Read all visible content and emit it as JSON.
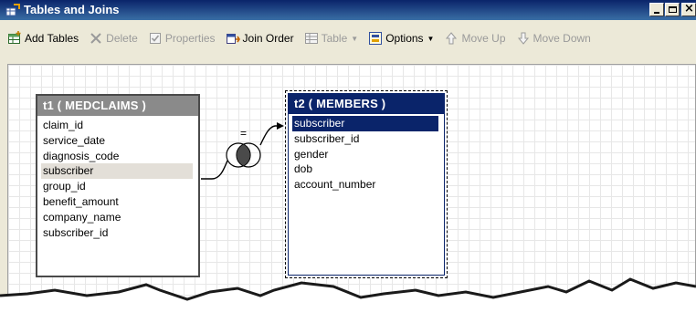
{
  "window": {
    "title": "Tables and Joins"
  },
  "toolbar": {
    "items": [
      {
        "label": "Add Tables",
        "icon": "add-table-icon",
        "enabled": true
      },
      {
        "label": "Delete",
        "icon": "delete-x-icon",
        "enabled": false
      },
      {
        "label": "Properties",
        "icon": "properties-icon",
        "enabled": false
      },
      {
        "label": "Join Order",
        "icon": "join-order-icon",
        "enabled": true
      },
      {
        "label": "Table",
        "icon": "table-icon",
        "enabled": false,
        "dropdown": true
      },
      {
        "label": "Options",
        "icon": "options-icon",
        "enabled": true,
        "dropdown": true
      },
      {
        "label": "Move Up",
        "icon": "arrow-up-icon",
        "enabled": false
      },
      {
        "label": "Move Down",
        "icon": "arrow-down-icon",
        "enabled": false
      }
    ]
  },
  "tables": [
    {
      "title": "t1 ( MEDCLAIMS )",
      "columns": [
        "claim_id",
        "service_date",
        "diagnosis_code",
        "subscriber",
        "group_id",
        "benefit_amount",
        "company_name",
        "subscriber_id"
      ],
      "highlighted": "subscriber"
    },
    {
      "title": "t2 ( MEMBERS )",
      "columns": [
        "subscriber",
        "subscriber_id",
        "gender",
        "dob",
        "account_number"
      ],
      "selected": "subscriber"
    }
  ],
  "join": {
    "operator": "=",
    "type_icon": "inner-join-venn-icon"
  },
  "colors": {
    "titlebar": "#0a246a",
    "selected": "#0a246a",
    "inactive_header": "#8a8a8a"
  }
}
